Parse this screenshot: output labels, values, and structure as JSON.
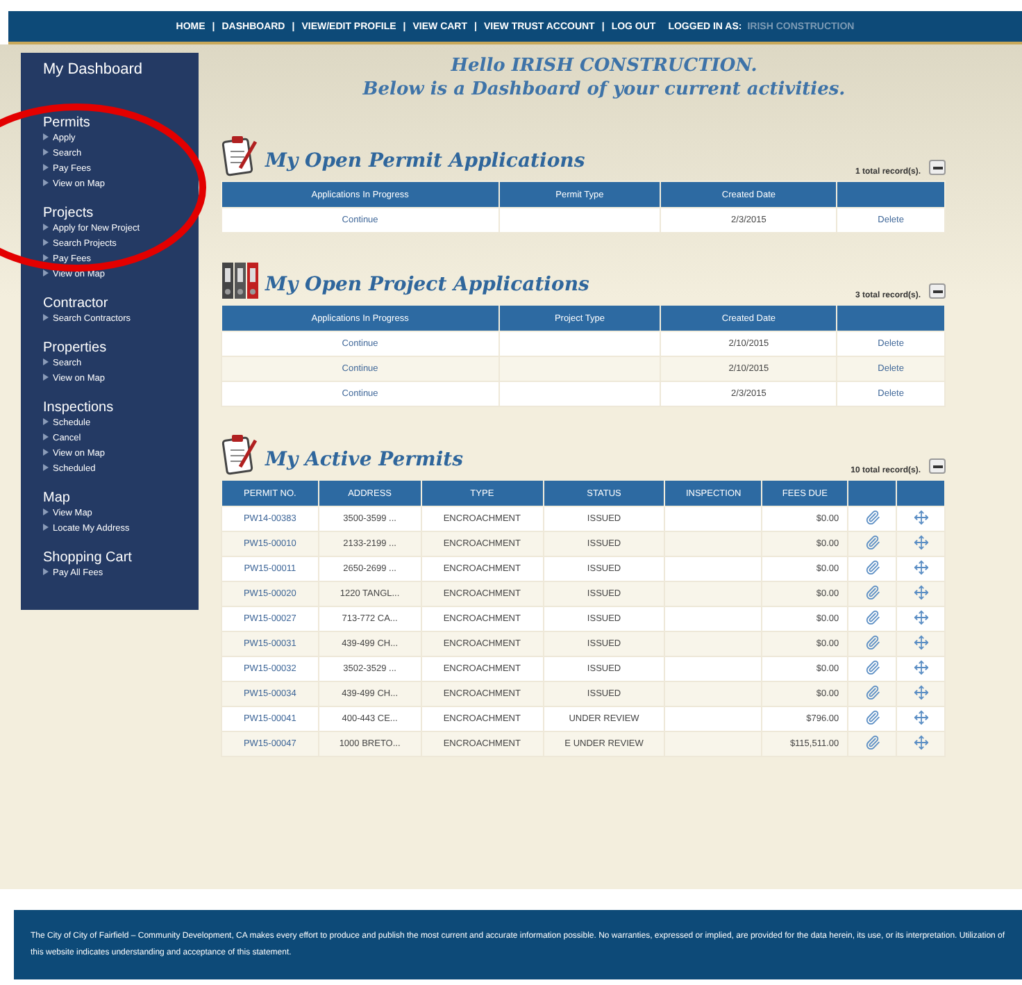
{
  "top_nav": {
    "links": [
      "HOME",
      "DASHBOARD",
      "VIEW/EDIT PROFILE",
      "VIEW CART",
      "VIEW TRUST ACCOUNT",
      "LOG OUT"
    ],
    "separator": "|",
    "logged_in_label": "LOGGED IN AS:",
    "logged_in_user": "IRISH CONSTRUCTION"
  },
  "sidebar": {
    "title": "My Dashboard",
    "sections": [
      {
        "heading": "Permits",
        "items": [
          "Apply",
          "Search",
          "Pay Fees",
          "View on Map"
        ]
      },
      {
        "heading": "Projects",
        "items": [
          "Apply for New Project",
          "Search Projects",
          "Pay Fees",
          "View on Map"
        ]
      },
      {
        "heading": "Contractor",
        "items": [
          "Search Contractors"
        ]
      },
      {
        "heading": "Properties",
        "items": [
          "Search",
          "View on Map"
        ]
      },
      {
        "heading": "Inspections",
        "items": [
          "Schedule",
          "Cancel",
          "View on Map",
          "Scheduled"
        ]
      },
      {
        "heading": "Map",
        "items": [
          "View Map",
          "Locate My Address"
        ]
      },
      {
        "heading": "Shopping Cart",
        "items": [
          "Pay All Fees"
        ]
      }
    ]
  },
  "greeting": [
    "Hello IRISH CONSTRUCTION.",
    "Below is a Dashboard of your current activities."
  ],
  "open_sections": [
    {
      "kind": "clipboard",
      "title": "My Open Permit Applications",
      "record_count": "1 total record(s).",
      "columns": [
        "Applications In Progress",
        "Permit Type",
        "Created Date",
        ""
      ],
      "rows": [
        {
          "action": "Continue",
          "created": "2/3/2015",
          "delete": "Delete"
        }
      ]
    },
    {
      "kind": "binders",
      "title": "My Open Project Applications",
      "record_count": "3 total record(s).",
      "columns": [
        "Applications In Progress",
        "Project Type",
        "Created Date",
        ""
      ],
      "rows": [
        {
          "action": "Continue",
          "created": "2/10/2015",
          "delete": "Delete"
        },
        {
          "action": "Continue",
          "created": "2/10/2015",
          "delete": "Delete"
        },
        {
          "action": "Continue",
          "created": "2/3/2015",
          "delete": "Delete"
        }
      ]
    }
  ],
  "active_permits": {
    "title": "My Active Permits",
    "record_count": "10 total record(s).",
    "columns": [
      "PERMIT NO.",
      "ADDRESS",
      "TYPE",
      "STATUS",
      "INSPECTION",
      "FEES DUE",
      "",
      ""
    ],
    "rows": [
      {
        "permit_no": "PW14-00383",
        "address": "3500-3599 ...",
        "type": "ENCROACHMENT",
        "status": "ISSUED",
        "fees_due": "$0.00"
      },
      {
        "permit_no": "PW15-00010",
        "address": "2133-2199 ...",
        "type": "ENCROACHMENT",
        "status": "ISSUED",
        "fees_due": "$0.00"
      },
      {
        "permit_no": "PW15-00011",
        "address": "2650-2699 ...",
        "type": "ENCROACHMENT",
        "status": "ISSUED",
        "fees_due": "$0.00"
      },
      {
        "permit_no": "PW15-00020",
        "address": "1220 TANGL...",
        "type": "ENCROACHMENT",
        "status": "ISSUED",
        "fees_due": "$0.00"
      },
      {
        "permit_no": "PW15-00027",
        "address": "713-772 CA...",
        "type": "ENCROACHMENT",
        "status": "ISSUED",
        "fees_due": "$0.00"
      },
      {
        "permit_no": "PW15-00031",
        "address": "439-499 CH...",
        "type": "ENCROACHMENT",
        "status": "ISSUED",
        "fees_due": "$0.00"
      },
      {
        "permit_no": "PW15-00032",
        "address": "3502-3529 ...",
        "type": "ENCROACHMENT",
        "status": "ISSUED",
        "fees_due": "$0.00"
      },
      {
        "permit_no": "PW15-00034",
        "address": "439-499 CH...",
        "type": "ENCROACHMENT",
        "status": "ISSUED",
        "fees_due": "$0.00"
      },
      {
        "permit_no": "PW15-00041",
        "address": "400-443 CE...",
        "type": "ENCROACHMENT",
        "status": "UNDER REVIEW",
        "fees_due": "$796.00"
      },
      {
        "permit_no": "PW15-00047",
        "address": "1000 BRETO...",
        "type": "ENCROACHMENT",
        "status": "E UNDER REVIEW",
        "fees_due": "$115,511.00"
      }
    ]
  },
  "footer": "The City of City of Fairfield – Community Development, CA makes every effort to produce and publish the most current and accurate information possible. No warranties, expressed or implied, are provided for the data herein, its use, or its interpretation. Utilization of this website indicates understanding and acceptance of this statement.",
  "annotation": {
    "color": "#e30000"
  }
}
